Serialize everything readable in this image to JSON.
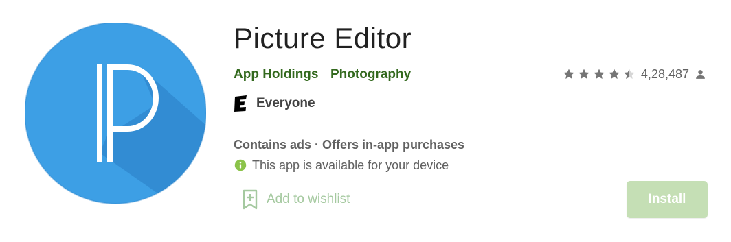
{
  "app": {
    "title": "Picture Editor",
    "developer": "App Holdings",
    "category": "Photography",
    "icon_name": "picsart-p-logo-icon",
    "icon_colors": {
      "circle": "#3d9fe5",
      "shadow": "#2f80c3",
      "letter": "#ffffff"
    }
  },
  "rating": {
    "stars": 4.5,
    "max_stars": 5,
    "count": "4,28,487",
    "count_icon": "person-icon"
  },
  "content_rating": {
    "icon": "esrb-everyone-icon",
    "label": "Everyone"
  },
  "monetization": {
    "text": "Contains ads · Offers in-app purchases"
  },
  "availability": {
    "icon": "info-icon",
    "text": "This app is available for your device"
  },
  "actions": {
    "wishlist_label": "Add to wishlist",
    "wishlist_icon": "bookmark-add-icon",
    "install_label": "Install"
  },
  "colors": {
    "accent_green": "#33691e",
    "install_bg": "#c5dfb5",
    "wishlist_text": "#a5c9a0",
    "info_green": "#8bc34a",
    "star_color": "#757575"
  }
}
